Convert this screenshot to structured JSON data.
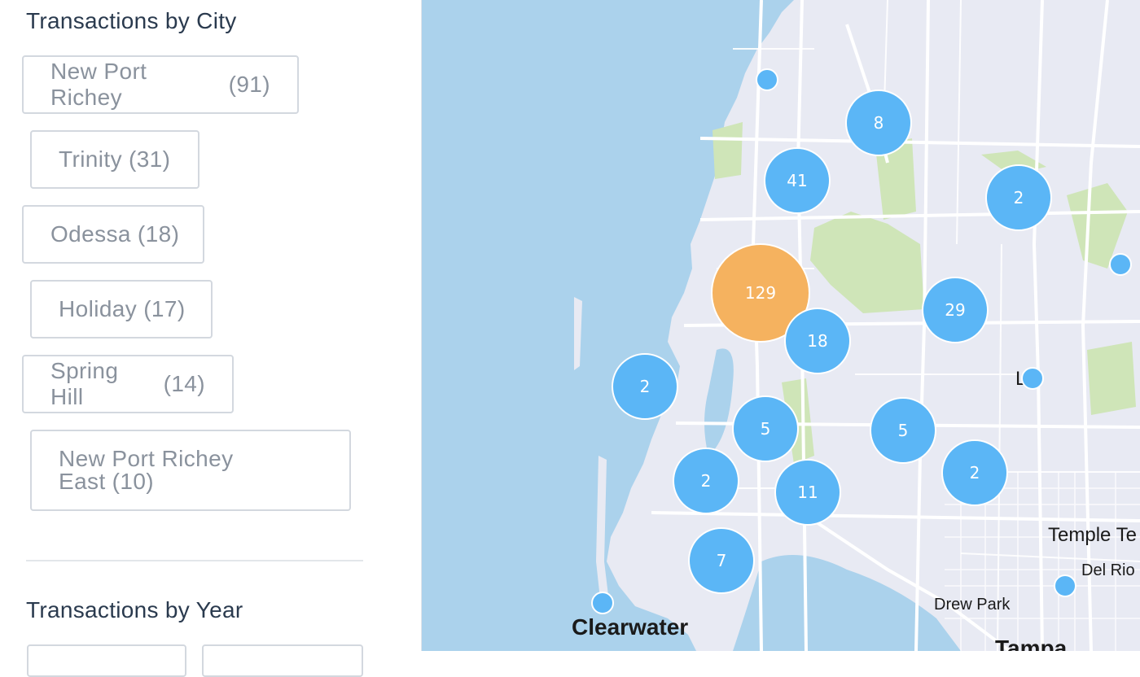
{
  "sidebar": {
    "city_section_title": "Transactions by City",
    "cities": [
      {
        "name": "New Port Richey",
        "count": "(91)"
      },
      {
        "name": "Trinity",
        "count": "(31)"
      },
      {
        "name": "Odessa",
        "count": "(18)"
      },
      {
        "name": "Holiday",
        "count": "(17)"
      },
      {
        "name": "Spring Hill",
        "count": "(14)"
      },
      {
        "name_line1": "New Port Richey",
        "name_line2": "East",
        "count": "(10)"
      }
    ],
    "year_section_title": "Transactions by Year"
  },
  "map": {
    "labels": [
      "Clearwater",
      "Tampa",
      "Drew Park",
      "Del Rio",
      "Temple Te",
      "L  z"
    ],
    "clusters": [
      {
        "count": "8"
      },
      {
        "count": "41"
      },
      {
        "count": "2"
      },
      {
        "count": "129"
      },
      {
        "count": "18"
      },
      {
        "count": "29"
      },
      {
        "count": "2"
      },
      {
        "count": "5"
      },
      {
        "count": "5"
      },
      {
        "count": "2"
      },
      {
        "count": "2"
      },
      {
        "count": "11"
      },
      {
        "count": "7"
      }
    ],
    "colors": {
      "water": "#abd2ec",
      "land": "#e8eaf3",
      "cluster": "#5bb6f6",
      "cluster_large": "#f5b25f",
      "park": "#cfe5b8"
    }
  }
}
